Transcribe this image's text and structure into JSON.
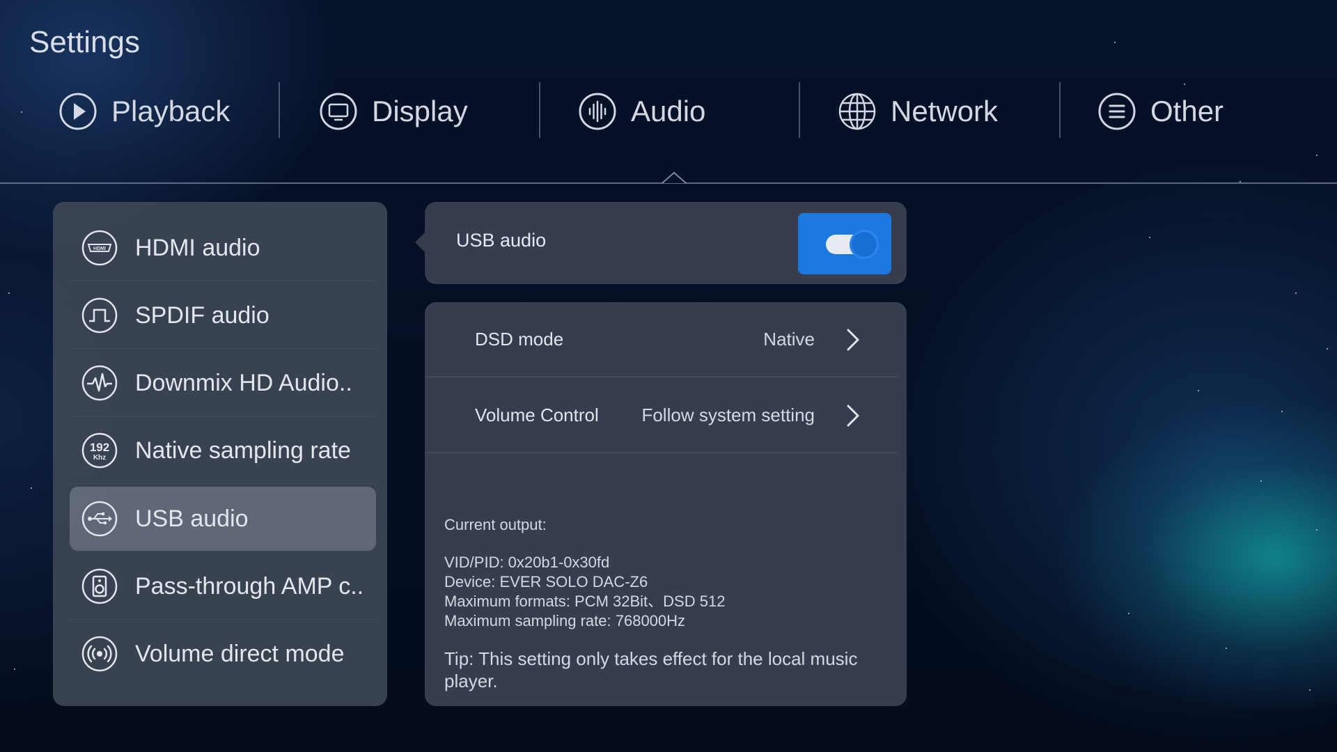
{
  "page_title": "Settings",
  "tabs": [
    {
      "label": "Playback",
      "icon": "play-circle-icon"
    },
    {
      "label": "Display",
      "icon": "monitor-icon"
    },
    {
      "label": "Audio",
      "icon": "audio-waveform-icon",
      "active": true
    },
    {
      "label": "Network",
      "icon": "globe-icon"
    },
    {
      "label": "Other",
      "icon": "menu-lines-icon"
    }
  ],
  "sidebar": {
    "items": [
      {
        "label": "HDMI audio",
        "icon": "hdmi-icon"
      },
      {
        "label": "SPDIF audio",
        "icon": "spdif-icon"
      },
      {
        "label": "Downmix HD Audio..",
        "icon": "pulse-icon"
      },
      {
        "label": "Native sampling rate",
        "icon": "192khz-icon",
        "icon_text_top": "192",
        "icon_text_bottom": "Khz"
      },
      {
        "label": "USB audio",
        "icon": "usb-icon",
        "active": true
      },
      {
        "label": "Pass-through AMP c..",
        "icon": "speaker-icon"
      },
      {
        "label": "Volume direct mode",
        "icon": "broadcast-icon"
      }
    ]
  },
  "usb_card": {
    "label": "USB audio",
    "toggle_on": true
  },
  "settings": {
    "dsd_mode": {
      "label": "DSD mode",
      "value": "Native"
    },
    "volume_control": {
      "label": "Volume Control",
      "value": "Follow system setting"
    }
  },
  "output_info": {
    "heading": "Current output:",
    "vid_pid": "VID/PID: 0x20b1-0x30fd",
    "device": "Device: EVER SOLO DAC-Z6",
    "max_formats": "Maximum formats: PCM 32Bit、DSD 512",
    "max_sampling_rate": "Maximum sampling rate: 768000Hz"
  },
  "tip": "Tip: This setting only takes effect for the local music player.",
  "colors": {
    "accent": "#1d78e0",
    "panel": "#3e4656",
    "background": "#06122a"
  }
}
